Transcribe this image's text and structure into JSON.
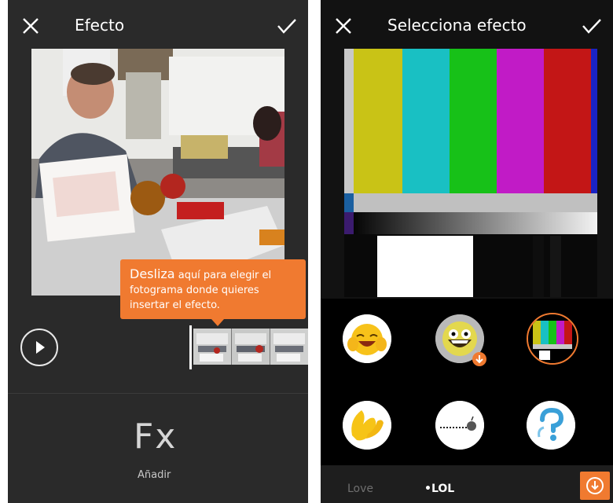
{
  "left_screen": {
    "title": "Efecto",
    "tooltip": {
      "strong": "Desliza",
      "rest": " aquí para elegir el fotograma donde quieres insertar el efecto."
    },
    "add_label": "Añadir",
    "fx_label": "Fx"
  },
  "right_screen": {
    "title": "Selecciona efecto",
    "tabs": [
      {
        "label": "Love",
        "selected": false
      },
      {
        "label": "•LOL",
        "selected": true
      }
    ]
  },
  "colors": {
    "accent": "#f07a30",
    "left_bg": "#2a2a2a",
    "right_bg": "#121212"
  }
}
